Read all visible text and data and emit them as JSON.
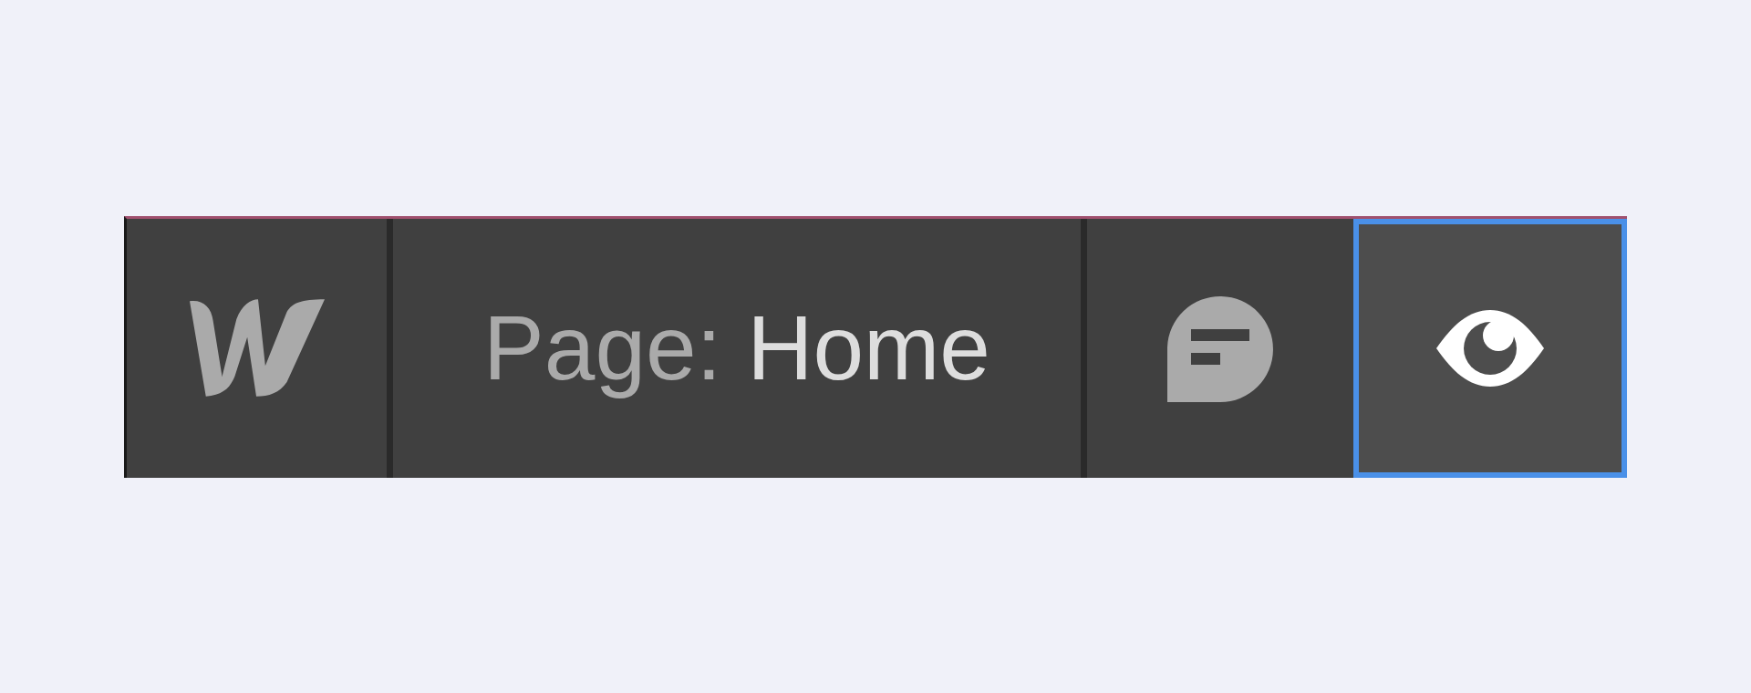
{
  "page_label": {
    "prefix": "Page:",
    "name": "Home"
  },
  "buttons": [
    {
      "kind": "comments",
      "selected": false
    },
    {
      "kind": "preview",
      "selected": true
    }
  ]
}
